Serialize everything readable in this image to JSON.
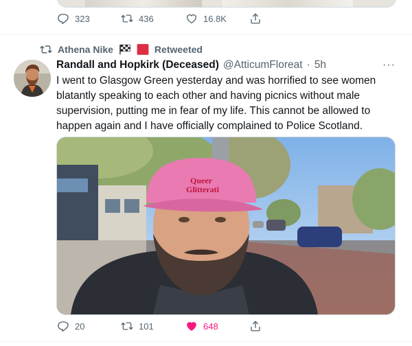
{
  "previous_tweet": {
    "reply_count": "323",
    "retweet_count": "436",
    "like_count": "16.8K"
  },
  "retweet_banner": {
    "retweeter": "Athena Nike",
    "label": "Retweeted"
  },
  "tweet": {
    "display_name": "Randall and Hopkirk (Deceased)",
    "handle": "@AtticumFloreat",
    "dot": "·",
    "time": "5h",
    "more": "···",
    "text": "I went to Glasgow Green yesterday and was horrified to see women blatantly speaking to each other and having picnics without male supervision, putting me in fear of my life. This cannot be allowed to happen again and I have officially complained to Police Scotland.",
    "photo": {
      "cap_text_line1": "Queer",
      "cap_text_line2": "Glitterati"
    },
    "reply_count": "20",
    "retweet_count": "101",
    "like_count": "648"
  },
  "colors": {
    "text_primary": "#0f1419",
    "text_secondary": "#536471",
    "like_active": "#f91880",
    "divider": "#eff3f4"
  },
  "icons": {
    "reply": "reply-icon",
    "retweet": "retweet-icon",
    "like": "heart-icon",
    "share": "share-icon"
  }
}
